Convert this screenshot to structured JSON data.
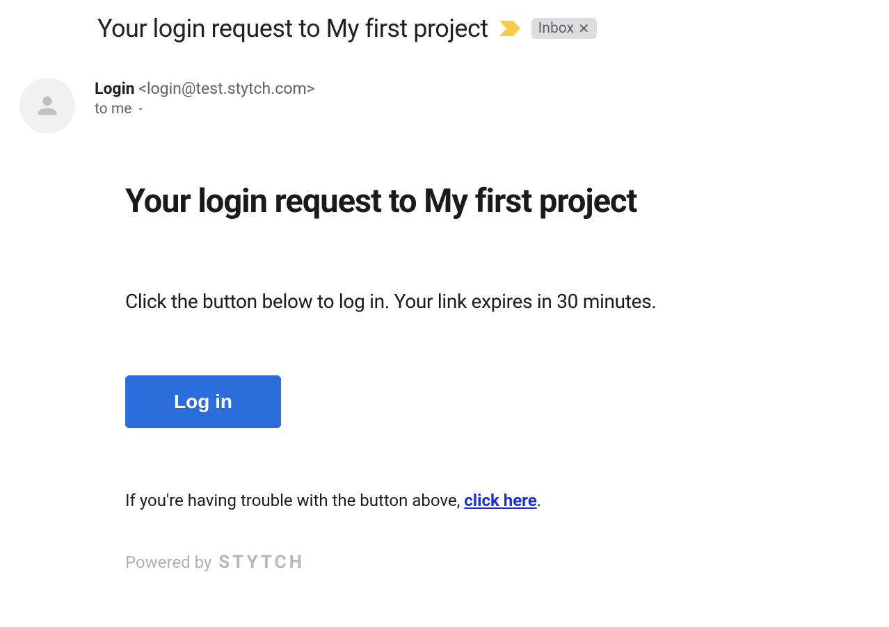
{
  "header": {
    "subject": "Your login request to My first project",
    "label": {
      "name": "Inbox"
    }
  },
  "sender": {
    "name": "Login",
    "email": "<login@test.stytch.com>",
    "recipient": "to me"
  },
  "body": {
    "heading": "Your login request to My first project",
    "instruction": "Click the button below to log in. Your link expires in 30 minutes.",
    "button_label": "Log in",
    "fallback_prefix": "If you're having trouble with the button above, ",
    "fallback_link": "click here",
    "fallback_suffix": ".",
    "powered_by_text": "Powered by",
    "powered_by_brand": "STYTCH"
  }
}
